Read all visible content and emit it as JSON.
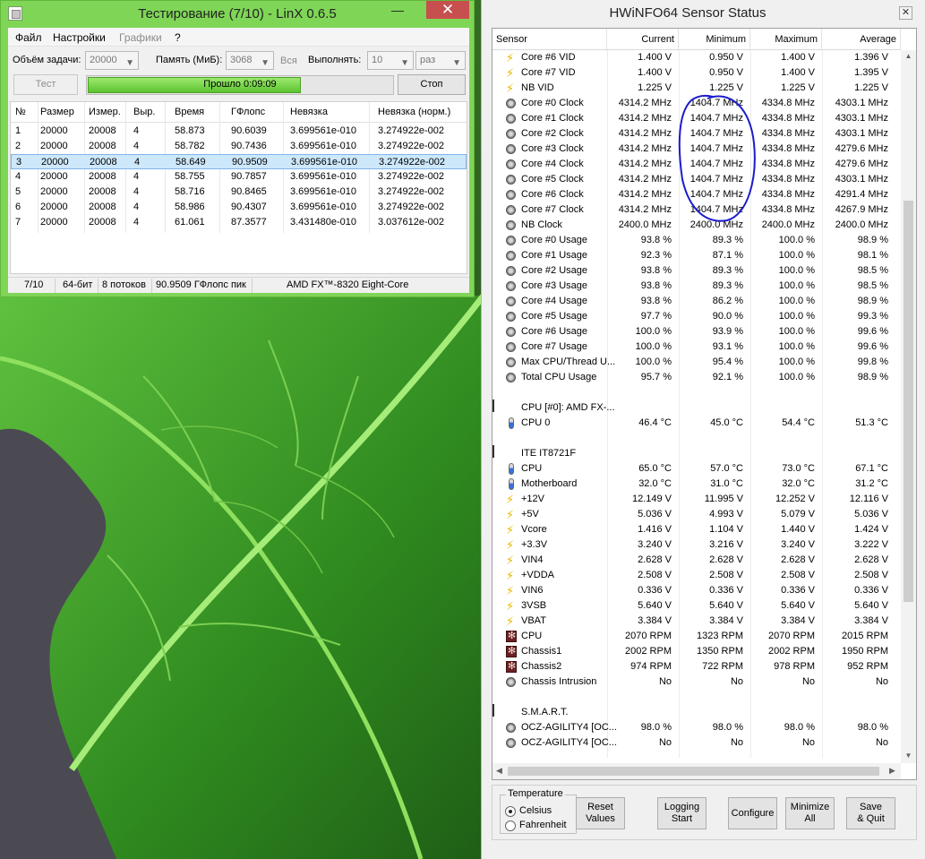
{
  "linx": {
    "title": "Тестирование (7/10) - LinX 0.6.5",
    "min_glyph": "—",
    "close_glyph": "✕",
    "menu": [
      "Файл",
      "Настройки",
      "Графики",
      "?"
    ],
    "labels": {
      "task_size": "Объём задачи:",
      "memory": "Память (МиБ):",
      "all": "Вся",
      "run": "Выполнять:"
    },
    "task_size_value": "20000",
    "memory_value": "3068",
    "run_value": "10",
    "run_unit": "раз",
    "test_button": "Тест",
    "stop_button": "Стоп",
    "progress_text": "Прошло 0:09:09",
    "progress_fraction": 0.7,
    "columns": [
      "№",
      "Размер",
      "Измер.",
      "Выр.",
      "Время",
      "ГФлопс",
      "Невязка",
      "Невязка (норм.)"
    ],
    "rows": [
      [
        "1",
        "20000",
        "20008",
        "4",
        "58.873",
        "90.6039",
        "3.699561e-010",
        "3.274922e-002"
      ],
      [
        "2",
        "20000",
        "20008",
        "4",
        "58.782",
        "90.7436",
        "3.699561e-010",
        "3.274922e-002"
      ],
      [
        "3",
        "20000",
        "20008",
        "4",
        "58.649",
        "90.9509",
        "3.699561e-010",
        "3.274922e-002"
      ],
      [
        "4",
        "20000",
        "20008",
        "4",
        "58.755",
        "90.7857",
        "3.699561e-010",
        "3.274922e-002"
      ],
      [
        "5",
        "20000",
        "20008",
        "4",
        "58.716",
        "90.8465",
        "3.699561e-010",
        "3.274922e-002"
      ],
      [
        "6",
        "20000",
        "20008",
        "4",
        "58.986",
        "90.4307",
        "3.699561e-010",
        "3.274922e-002"
      ],
      [
        "7",
        "20000",
        "20008",
        "4",
        "61.061",
        "87.3577",
        "3.431480e-010",
        "3.037612e-002"
      ]
    ],
    "selected_row": 3,
    "status": {
      "progress": "7/10",
      "bits": "64-бит",
      "threads": "8 потоков",
      "peak": "90.9509 ГФлопс пик",
      "cpu": "AMD FX™-8320 Eight-Core"
    }
  },
  "hwinfo": {
    "title": "HWiNFO64 Sensor Status",
    "close_glyph": "✕",
    "columns": [
      "Sensor",
      "Current",
      "Minimum",
      "Maximum",
      "Average"
    ],
    "rows": [
      {
        "icon": "volt",
        "name": "Core #6 VID",
        "v": [
          "1.400 V",
          "0.950 V",
          "1.400 V",
          "1.396 V"
        ]
      },
      {
        "icon": "volt",
        "name": "Core #7 VID",
        "v": [
          "1.400 V",
          "0.950 V",
          "1.400 V",
          "1.395 V"
        ]
      },
      {
        "icon": "volt",
        "name": "NB VID",
        "v": [
          "1.225 V",
          "1.225 V",
          "1.225 V",
          "1.225 V"
        ]
      },
      {
        "icon": "clock",
        "name": "Core #0 Clock",
        "v": [
          "4314.2 MHz",
          "1404.7 MHz",
          "4334.8 MHz",
          "4303.1 MHz"
        ]
      },
      {
        "icon": "clock",
        "name": "Core #1 Clock",
        "v": [
          "4314.2 MHz",
          "1404.7 MHz",
          "4334.8 MHz",
          "4303.1 MHz"
        ]
      },
      {
        "icon": "clock",
        "name": "Core #2 Clock",
        "v": [
          "4314.2 MHz",
          "1404.7 MHz",
          "4334.8 MHz",
          "4303.1 MHz"
        ]
      },
      {
        "icon": "clock",
        "name": "Core #3 Clock",
        "v": [
          "4314.2 MHz",
          "1404.7 MHz",
          "4334.8 MHz",
          "4279.6 MHz"
        ]
      },
      {
        "icon": "clock",
        "name": "Core #4 Clock",
        "v": [
          "4314.2 MHz",
          "1404.7 MHz",
          "4334.8 MHz",
          "4279.6 MHz"
        ]
      },
      {
        "icon": "clock",
        "name": "Core #5 Clock",
        "v": [
          "4314.2 MHz",
          "1404.7 MHz",
          "4334.8 MHz",
          "4303.1 MHz"
        ]
      },
      {
        "icon": "clock",
        "name": "Core #6 Clock",
        "v": [
          "4314.2 MHz",
          "1404.7 MHz",
          "4334.8 MHz",
          "4291.4 MHz"
        ]
      },
      {
        "icon": "clock",
        "name": "Core #7 Clock",
        "v": [
          "4314.2 MHz",
          "1404.7 MHz",
          "4334.8 MHz",
          "4267.9 MHz"
        ]
      },
      {
        "icon": "clock",
        "name": "NB Clock",
        "v": [
          "2400.0 MHz",
          "2400.0 MHz",
          "2400.0 MHz",
          "2400.0 MHz"
        ]
      },
      {
        "icon": "clock",
        "name": "Core #0 Usage",
        "v": [
          "93.8 %",
          "89.3 %",
          "100.0 %",
          "98.9 %"
        ]
      },
      {
        "icon": "clock",
        "name": "Core #1 Usage",
        "v": [
          "92.3 %",
          "87.1 %",
          "100.0 %",
          "98.1 %"
        ]
      },
      {
        "icon": "clock",
        "name": "Core #2 Usage",
        "v": [
          "93.8 %",
          "89.3 %",
          "100.0 %",
          "98.5 %"
        ]
      },
      {
        "icon": "clock",
        "name": "Core #3 Usage",
        "v": [
          "93.8 %",
          "89.3 %",
          "100.0 %",
          "98.5 %"
        ]
      },
      {
        "icon": "clock",
        "name": "Core #4 Usage",
        "v": [
          "93.8 %",
          "86.2 %",
          "100.0 %",
          "98.9 %"
        ]
      },
      {
        "icon": "clock",
        "name": "Core #5 Usage",
        "v": [
          "97.7 %",
          "90.0 %",
          "100.0 %",
          "99.3 %"
        ]
      },
      {
        "icon": "clock",
        "name": "Core #6 Usage",
        "v": [
          "100.0 %",
          "93.9 %",
          "100.0 %",
          "99.6 %"
        ]
      },
      {
        "icon": "clock",
        "name": "Core #7 Usage",
        "v": [
          "100.0 %",
          "93.1 %",
          "100.0 %",
          "99.6 %"
        ]
      },
      {
        "icon": "clock",
        "name": "Max CPU/Thread U...",
        "v": [
          "100.0 %",
          "95.4 %",
          "100.0 %",
          "99.8 %"
        ]
      },
      {
        "icon": "clock",
        "name": "Total CPU Usage",
        "v": [
          "95.7 %",
          "92.1 %",
          "100.0 %",
          "98.9 %"
        ]
      },
      {
        "icon": "blank",
        "name": "",
        "v": [
          "",
          "",
          "",
          ""
        ]
      },
      {
        "icon": "chip",
        "name": "CPU [#0]: AMD FX-...",
        "group": true,
        "v": [
          "",
          "",
          "",
          ""
        ]
      },
      {
        "icon": "temp",
        "name": "CPU 0",
        "v": [
          "46.4 °C",
          "45.0 °C",
          "54.4 °C",
          "51.3 °C"
        ]
      },
      {
        "icon": "blank",
        "name": "",
        "v": [
          "",
          "",
          "",
          ""
        ]
      },
      {
        "icon": "chip",
        "name": "ITE IT8721F",
        "group": true,
        "v": [
          "",
          "",
          "",
          ""
        ]
      },
      {
        "icon": "temp",
        "name": "CPU",
        "v": [
          "65.0 °C",
          "57.0 °C",
          "73.0 °C",
          "67.1 °C"
        ]
      },
      {
        "icon": "temp",
        "name": "Motherboard",
        "v": [
          "32.0 °C",
          "31.0 °C",
          "32.0 °C",
          "31.2 °C"
        ]
      },
      {
        "icon": "volt",
        "name": "+12V",
        "v": [
          "12.149 V",
          "11.995 V",
          "12.252 V",
          "12.116 V"
        ]
      },
      {
        "icon": "volt",
        "name": "+5V",
        "v": [
          "5.036 V",
          "4.993 V",
          "5.079 V",
          "5.036 V"
        ]
      },
      {
        "icon": "volt",
        "name": "Vcore",
        "v": [
          "1.416 V",
          "1.104 V",
          "1.440 V",
          "1.424 V"
        ]
      },
      {
        "icon": "volt",
        "name": "+3.3V",
        "v": [
          "3.240 V",
          "3.216 V",
          "3.240 V",
          "3.222 V"
        ]
      },
      {
        "icon": "volt",
        "name": "VIN4",
        "v": [
          "2.628 V",
          "2.628 V",
          "2.628 V",
          "2.628 V"
        ]
      },
      {
        "icon": "volt",
        "name": "+VDDA",
        "v": [
          "2.508 V",
          "2.508 V",
          "2.508 V",
          "2.508 V"
        ]
      },
      {
        "icon": "volt",
        "name": "VIN6",
        "v": [
          "0.336 V",
          "0.336 V",
          "0.336 V",
          "0.336 V"
        ]
      },
      {
        "icon": "volt",
        "name": "3VSB",
        "v": [
          "5.640 V",
          "5.640 V",
          "5.640 V",
          "5.640 V"
        ]
      },
      {
        "icon": "volt",
        "name": "VBAT",
        "v": [
          "3.384 V",
          "3.384 V",
          "3.384 V",
          "3.384 V"
        ]
      },
      {
        "icon": "fan",
        "name": "CPU",
        "v": [
          "2070 RPM",
          "1323 RPM",
          "2070 RPM",
          "2015 RPM"
        ]
      },
      {
        "icon": "fan",
        "name": "Chassis1",
        "v": [
          "2002 RPM",
          "1350 RPM",
          "2002 RPM",
          "1950 RPM"
        ]
      },
      {
        "icon": "fan",
        "name": "Chassis2",
        "v": [
          "974 RPM",
          "722 RPM",
          "978 RPM",
          "952 RPM"
        ]
      },
      {
        "icon": "clock",
        "name": "Chassis Intrusion",
        "v": [
          "No",
          "No",
          "No",
          "No"
        ]
      },
      {
        "icon": "blank",
        "name": "",
        "v": [
          "",
          "",
          "",
          ""
        ]
      },
      {
        "icon": "chip",
        "name": "S.M.A.R.T.",
        "group": true,
        "v": [
          "",
          "",
          "",
          ""
        ]
      },
      {
        "icon": "clock",
        "name": "OCZ-AGILITY4 [OC...",
        "v": [
          "98.0 %",
          "98.0 %",
          "98.0 %",
          "98.0 %"
        ]
      },
      {
        "icon": "clock",
        "name": "OCZ-AGILITY4 [OC...",
        "v": [
          "No",
          "No",
          "No",
          "No"
        ]
      }
    ],
    "temperature_label": "Temperature",
    "celsius": "Celsius",
    "fahrenheit": "Fahrenheit",
    "selected_unit": "Celsius",
    "buttons": [
      {
        "id": "reset-values",
        "label": "Reset\nValues"
      },
      {
        "id": "logging-start",
        "label": "Logging\nStart"
      },
      {
        "id": "configure",
        "label": "Configure"
      },
      {
        "id": "minimize-all",
        "label": "Minimize\nAll"
      },
      {
        "id": "save-quit",
        "label": "Save\n& Quit"
      }
    ]
  },
  "colors": {
    "linx_frame": "#7fd656",
    "progress_fill": "#5cc42f",
    "annotation_ink": "#1c1ccc",
    "leaf_green": "#2f8a1f"
  }
}
